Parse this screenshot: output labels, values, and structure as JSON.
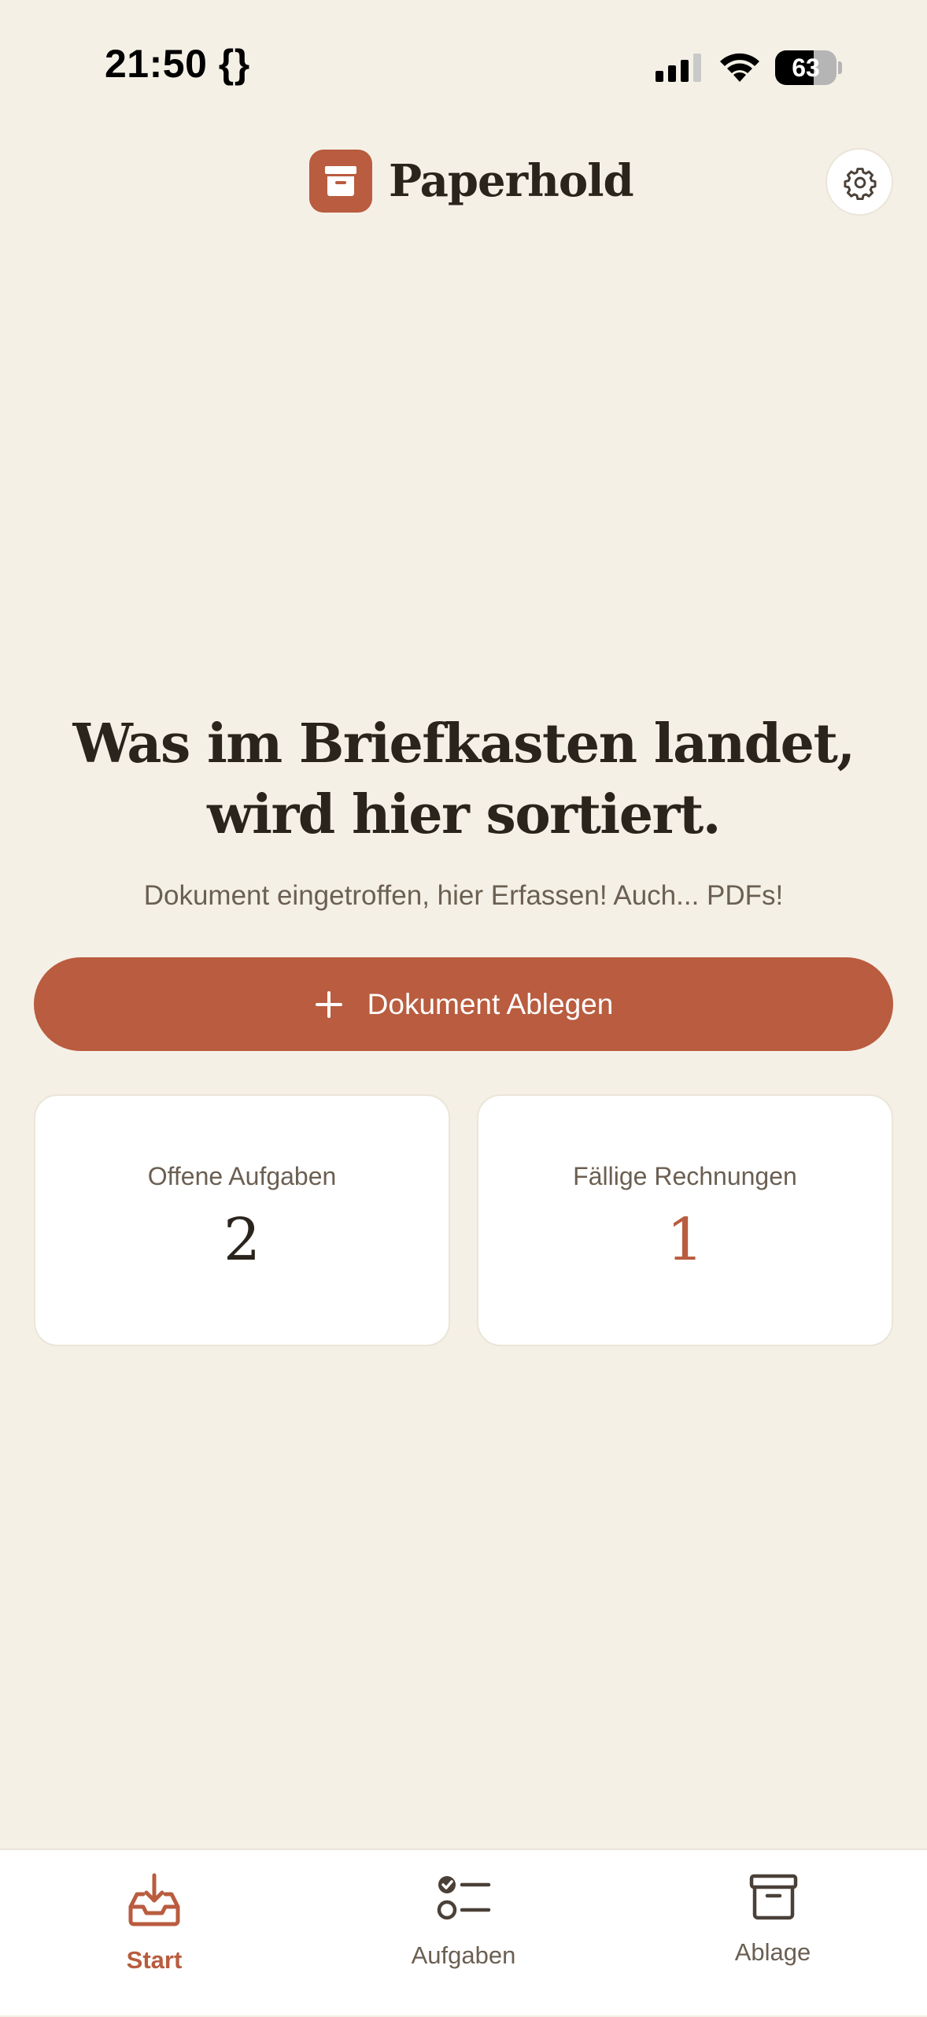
{
  "status_bar": {
    "time": "21:50 {}",
    "battery": "63"
  },
  "header": {
    "app_name": "Paperhold",
    "logo_icon": "archive-box-icon",
    "settings_icon": "gear-icon"
  },
  "hero": {
    "headline": "Was im Briefkasten landet, wird hier sortiert.",
    "subline": "Dokument eingetroffen, hier Erfassen! Auch... PDFs!"
  },
  "cta": {
    "label": "Dokument Ablegen",
    "icon": "plus-icon"
  },
  "stats": [
    {
      "label": "Offene Aufgaben",
      "value": "2"
    },
    {
      "label": "Fällige Rechnungen",
      "value": "1",
      "accent": "#b95c3f"
    }
  ],
  "bottom_nav": {
    "items": [
      {
        "label": "Start",
        "icon": "inbox-download-icon",
        "active": true
      },
      {
        "label": "Aufgaben",
        "icon": "checklist-icon",
        "active": false
      },
      {
        "label": "Ablage",
        "icon": "archive-box-icon",
        "active": false
      }
    ]
  },
  "colors": {
    "background": "#f5f0e6",
    "accent": "#b95c3f",
    "text": "#2a241c",
    "muted": "#6b5f52"
  }
}
